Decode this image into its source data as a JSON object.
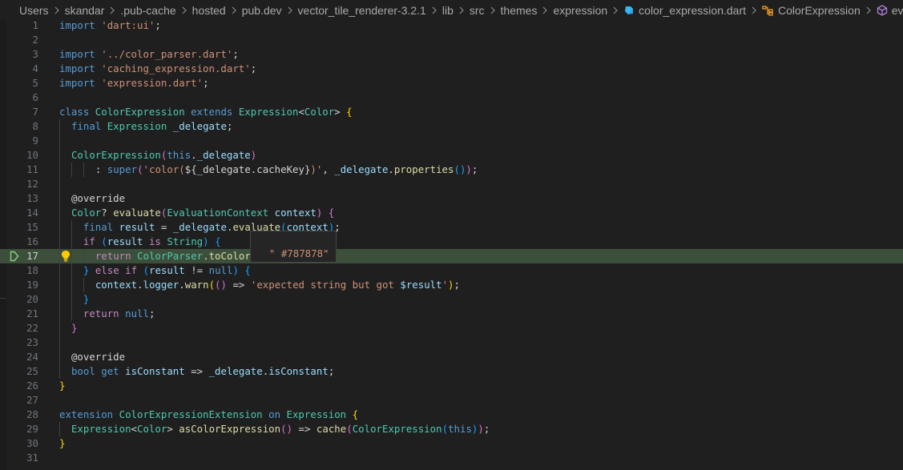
{
  "breadcrumb": {
    "items": [
      {
        "label": "Users",
        "icon": null
      },
      {
        "label": "skandar",
        "icon": null
      },
      {
        "label": ".pub-cache",
        "icon": null
      },
      {
        "label": "hosted",
        "icon": null
      },
      {
        "label": "pub.dev",
        "icon": null
      },
      {
        "label": "vector_tile_renderer-3.2.1",
        "icon": null
      },
      {
        "label": "lib",
        "icon": null
      },
      {
        "label": "src",
        "icon": null
      },
      {
        "label": "themes",
        "icon": null
      },
      {
        "label": "expression",
        "icon": null
      },
      {
        "label": "color_expression.dart",
        "icon": "dart-file-icon"
      },
      {
        "label": "ColorExpression",
        "icon": "class-symbol-icon"
      },
      {
        "label": "evaluate",
        "icon": "method-symbol-icon"
      }
    ],
    "separator": "chevron-right-icon"
  },
  "editor": {
    "file": "color_expression.dart",
    "language": "dart",
    "current_line": 17,
    "breakpoint_marker_line": 17,
    "lightbulb_line": 17,
    "line_numbers": [
      "1",
      "2",
      "3",
      "4",
      "5",
      "6",
      "7",
      "8",
      "9",
      "10",
      "11",
      "12",
      "13",
      "14",
      "15",
      "16",
      "17",
      "18",
      "19",
      "20",
      "21",
      "22",
      "23",
      "24",
      "25",
      "26",
      "27",
      "28",
      "29",
      "30",
      "31"
    ],
    "lines": [
      "import 'dart:ui';",
      "",
      "import '../color_parser.dart';",
      "import 'caching_expression.dart';",
      "import 'expression.dart';",
      "",
      "class ColorExpression extends Expression<Color> {",
      "  final Expression _delegate;",
      "",
      "  ColorExpression(this._delegate)",
      "      : super('color(${_delegate.cacheKey})', _delegate.properties());",
      "",
      "  @override",
      "  Color? evaluate(EvaluationContext context) {",
      "    final result = _delegate.evaluate(context);",
      "    if (result is String) {",
      "      return ColorParser.toColor(result);",
      "    } else if (result != null) {",
      "      context.logger.warn(() => 'expected string but got $result');",
      "    }",
      "    return null;",
      "  }",
      "",
      "  @override",
      "  bool get isConstant => _delegate.isConstant;",
      "}",
      "",
      "extension ColorExpressionExtension on Expression {",
      "  Expression<Color> asColorExpression() => cache(ColorExpression(this));",
      "}",
      ""
    ]
  },
  "hover_tooltip": {
    "value": "\" #787878\"",
    "target": "result"
  },
  "colors": {
    "editor_bg": "#1f1f1f",
    "current_line_bg": "#3c4f3a",
    "keyword": "#569cd6",
    "control": "#c586c0",
    "string": "#ce9178",
    "type": "#4ec9b0",
    "function": "#dcdcaa",
    "variable": "#9cdcfe",
    "debug_marker": "#89d185",
    "lightbulb": "#ffcc00"
  }
}
